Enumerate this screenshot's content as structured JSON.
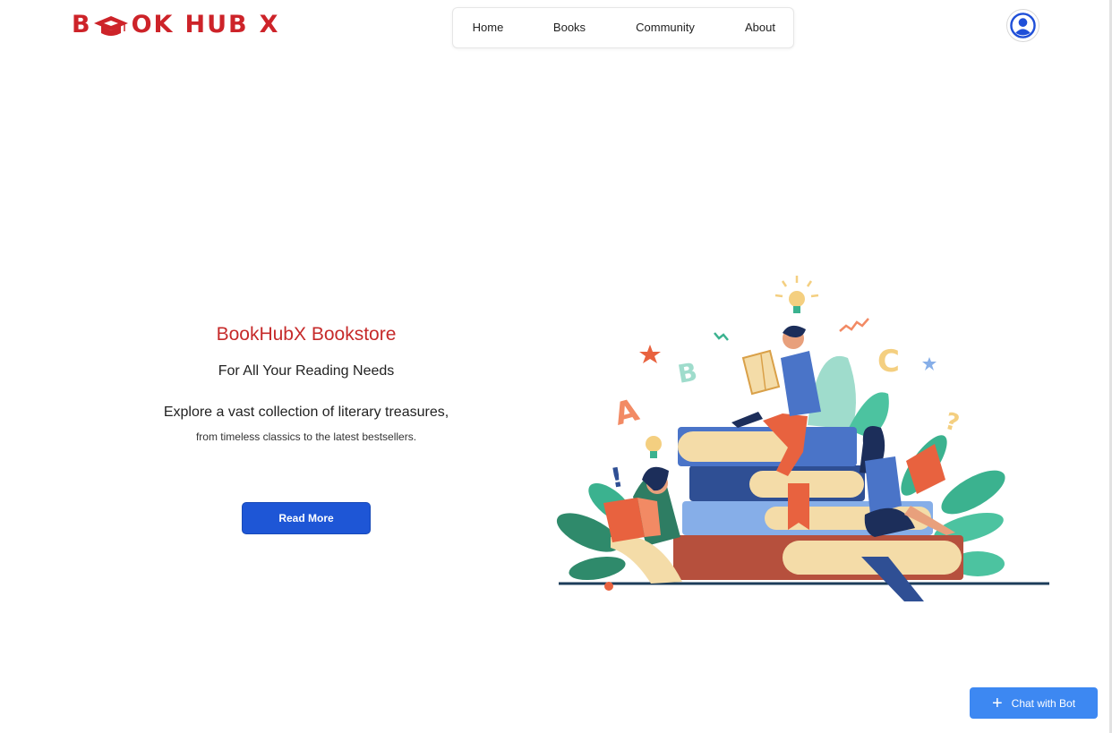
{
  "brand": {
    "logo_part1": "B",
    "logo_part2": "OK",
    "logo_part3": "HUB",
    "logo_part4": "X",
    "logo_icon": "graduation-cap-icon",
    "brand_color": "#cd2329"
  },
  "nav": {
    "items": [
      {
        "label": "Home"
      },
      {
        "label": "Books"
      },
      {
        "label": "Community"
      },
      {
        "label": "About"
      }
    ]
  },
  "header": {
    "avatar_icon": "user-avatar-icon"
  },
  "hero": {
    "title": "BookHubX Bookstore",
    "subtitle": "For All Your Reading Needs",
    "description_line1": "Explore a vast collection of literary treasures,",
    "description_line2": "from timeless classics to the latest bestsellers.",
    "cta_label": "Read More",
    "cta_color": "#1e56d6"
  },
  "illustration": {
    "icon": "people-reading-on-books-illustration"
  },
  "chat": {
    "label": "Chat with Bot",
    "icon": "plus-icon",
    "color": "#3d88f2"
  }
}
